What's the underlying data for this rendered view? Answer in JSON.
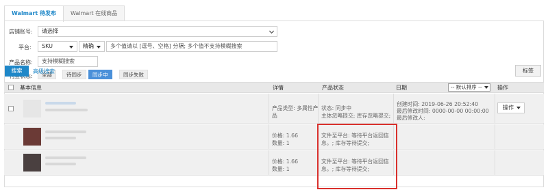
{
  "tabs": [
    {
      "label": "Walmart 待发布",
      "active": true
    },
    {
      "label": "Walmart 在线商品",
      "active": false
    }
  ],
  "filters": {
    "store_label": "店铺账号:",
    "store_value": "请选择",
    "platform_label": "平台:",
    "platform_value": "SKU",
    "match_value": "精确",
    "platform_placeholder": "多个值请以 [逗号、空格] 分隔; 多个值不支持模糊搜索",
    "product_label": "产品名称:",
    "product_placeholder": "支持模糊搜索",
    "status_label": "刊登状态:",
    "status_options": [
      "全部",
      "待同步",
      "同步中",
      "同步失败"
    ],
    "status_active_index": 2
  },
  "actions": {
    "search": "搜索",
    "advanced": "高级搜索",
    "tag": "标签"
  },
  "table": {
    "headers": {
      "basic": "基本信息",
      "detail": "详情",
      "status": "产品状态",
      "date": "日期",
      "sort": "-- 默认排序 --",
      "op": "操作"
    },
    "rows": [
      {
        "detail_line1": "产品类型: 多属性产",
        "detail_line2": "品",
        "status_line1": "状态: 同步中",
        "status_line2": "主体忽略提交; 库存忽略提交;",
        "date_line1": "创建时间: 2019-06-26 20:52:40",
        "date_line2": "最后修改时间: 0000-00-00 00:00:00",
        "date_line3": "最后修改人:",
        "op": "操作"
      },
      {
        "detail_line1": "价格: 1.66",
        "detail_line2": "数量: 1",
        "status_line1": "文件至平台: 等待平台返回信",
        "status_line2": "息。; 库存等待提交;"
      },
      {
        "detail_line1": "价格: 1.66",
        "detail_line2": "数量: 1",
        "status_line1": "文件至平台: 等待平台返回信",
        "status_line2": "息。; 库存等待提交;"
      }
    ]
  },
  "colors": {
    "accent": "#1e87c8",
    "highlight": "#d9302c"
  }
}
